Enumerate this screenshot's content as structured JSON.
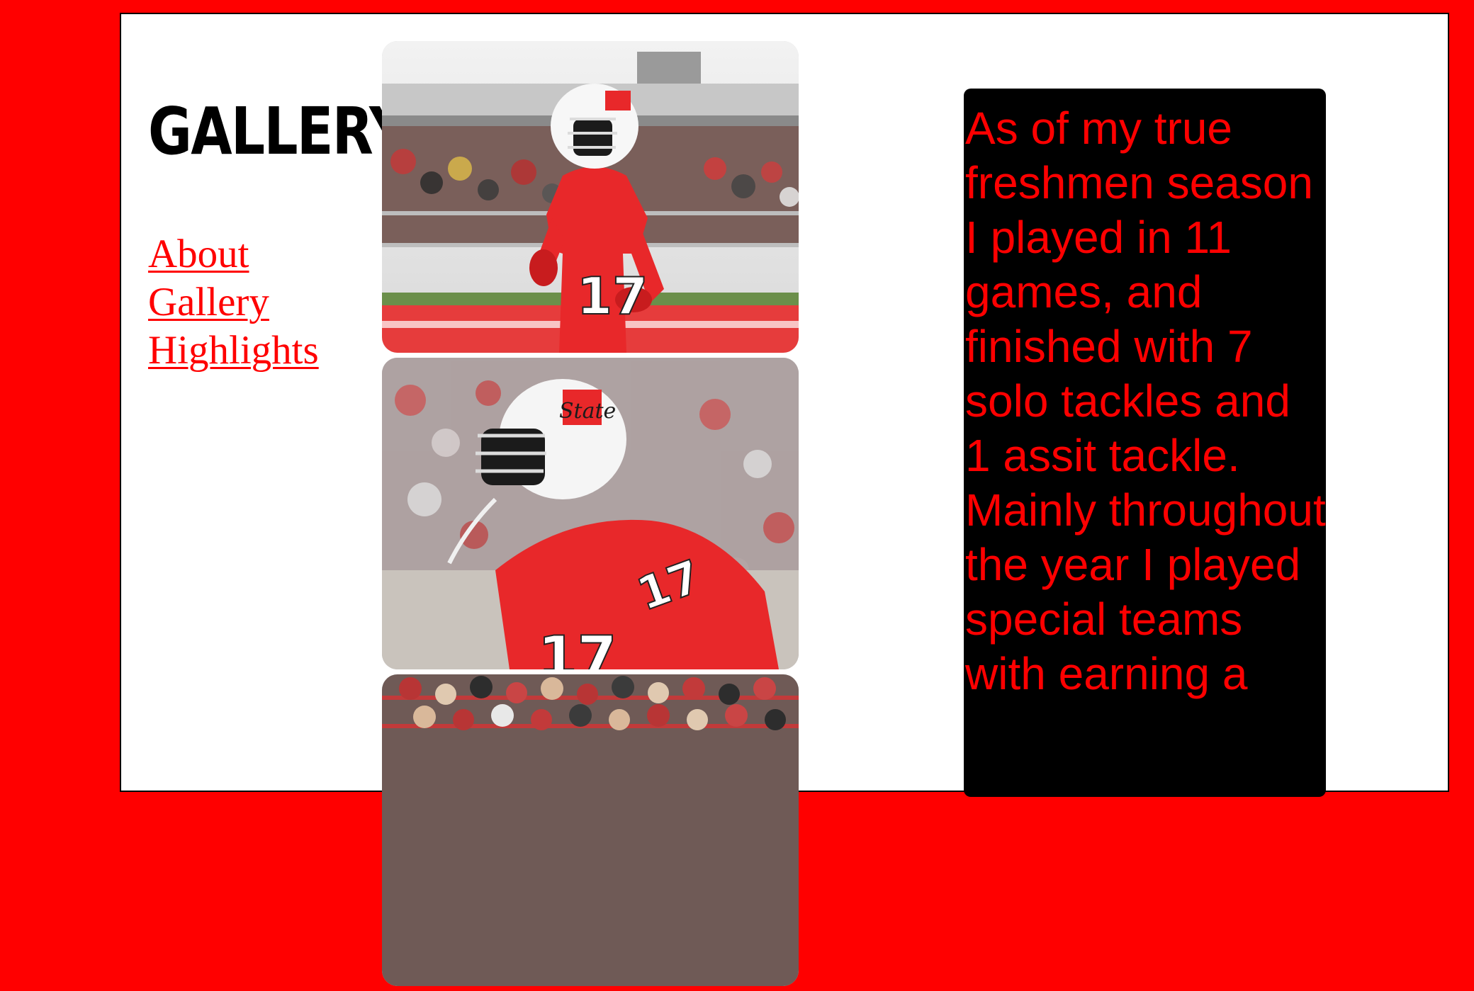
{
  "page": {
    "heading": "GALLERY"
  },
  "nav": {
    "items": [
      {
        "label": "About"
      },
      {
        "label": "Gallery"
      },
      {
        "label": "Highlights"
      }
    ]
  },
  "gallery": {
    "photos": [
      {
        "alt": "Football player number 17 in red jersey and white helmet on the field"
      },
      {
        "alt": "Close-up of football player number 17 in red jersey and white helmet"
      },
      {
        "alt": "Crowd of fans in the stadium stands"
      }
    ]
  },
  "stats": {
    "text": "As of my true freshmen season I played in 11 games, and finished with 7 solo tackles and 1 assit tackle. Mainly throughout the year I played special teams with earning a"
  },
  "colors": {
    "background": "#ff0000",
    "panel": "#ffffff",
    "accent": "#ff0000",
    "stats_box": "#000000"
  }
}
